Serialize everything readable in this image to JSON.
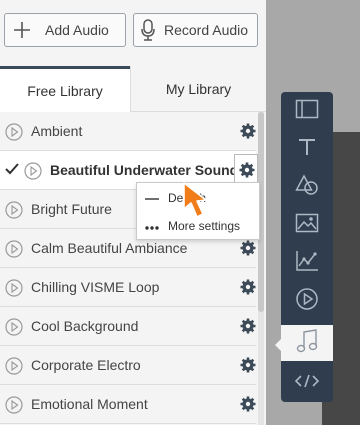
{
  "toolbar_top": {
    "add_audio_label": "Add Audio",
    "record_audio_label": "Record Audio",
    "add_icon": "plus-icon",
    "record_icon": "microphone-icon"
  },
  "tabs": [
    {
      "label": "Free Library",
      "active": true
    },
    {
      "label": "My Library",
      "active": false
    }
  ],
  "tracks": [
    {
      "name": "Ambient"
    },
    {
      "name": "Beautiful Underwater Sounds",
      "selected": true
    },
    {
      "name": "Bright Future"
    },
    {
      "name": "Calm Beautiful Ambiance"
    },
    {
      "name": "Chilling VISME Loop"
    },
    {
      "name": "Cool Background"
    },
    {
      "name": "Corporate Electro"
    },
    {
      "name": "Emotional Moment"
    }
  ],
  "context_menu": {
    "detach_label": "Detach",
    "more_settings_label": "More settings"
  },
  "side_tools": [
    {
      "icon": "layout-icon"
    },
    {
      "icon": "text-icon"
    },
    {
      "icon": "shapes-icon"
    },
    {
      "icon": "image-icon"
    },
    {
      "icon": "chart-icon"
    },
    {
      "icon": "video-icon"
    },
    {
      "icon": "music-icon",
      "active": true
    },
    {
      "icon": "code-icon"
    }
  ],
  "colors": {
    "toolbar_bg": "#2f3d4e",
    "cursor": "#f07d1a"
  }
}
